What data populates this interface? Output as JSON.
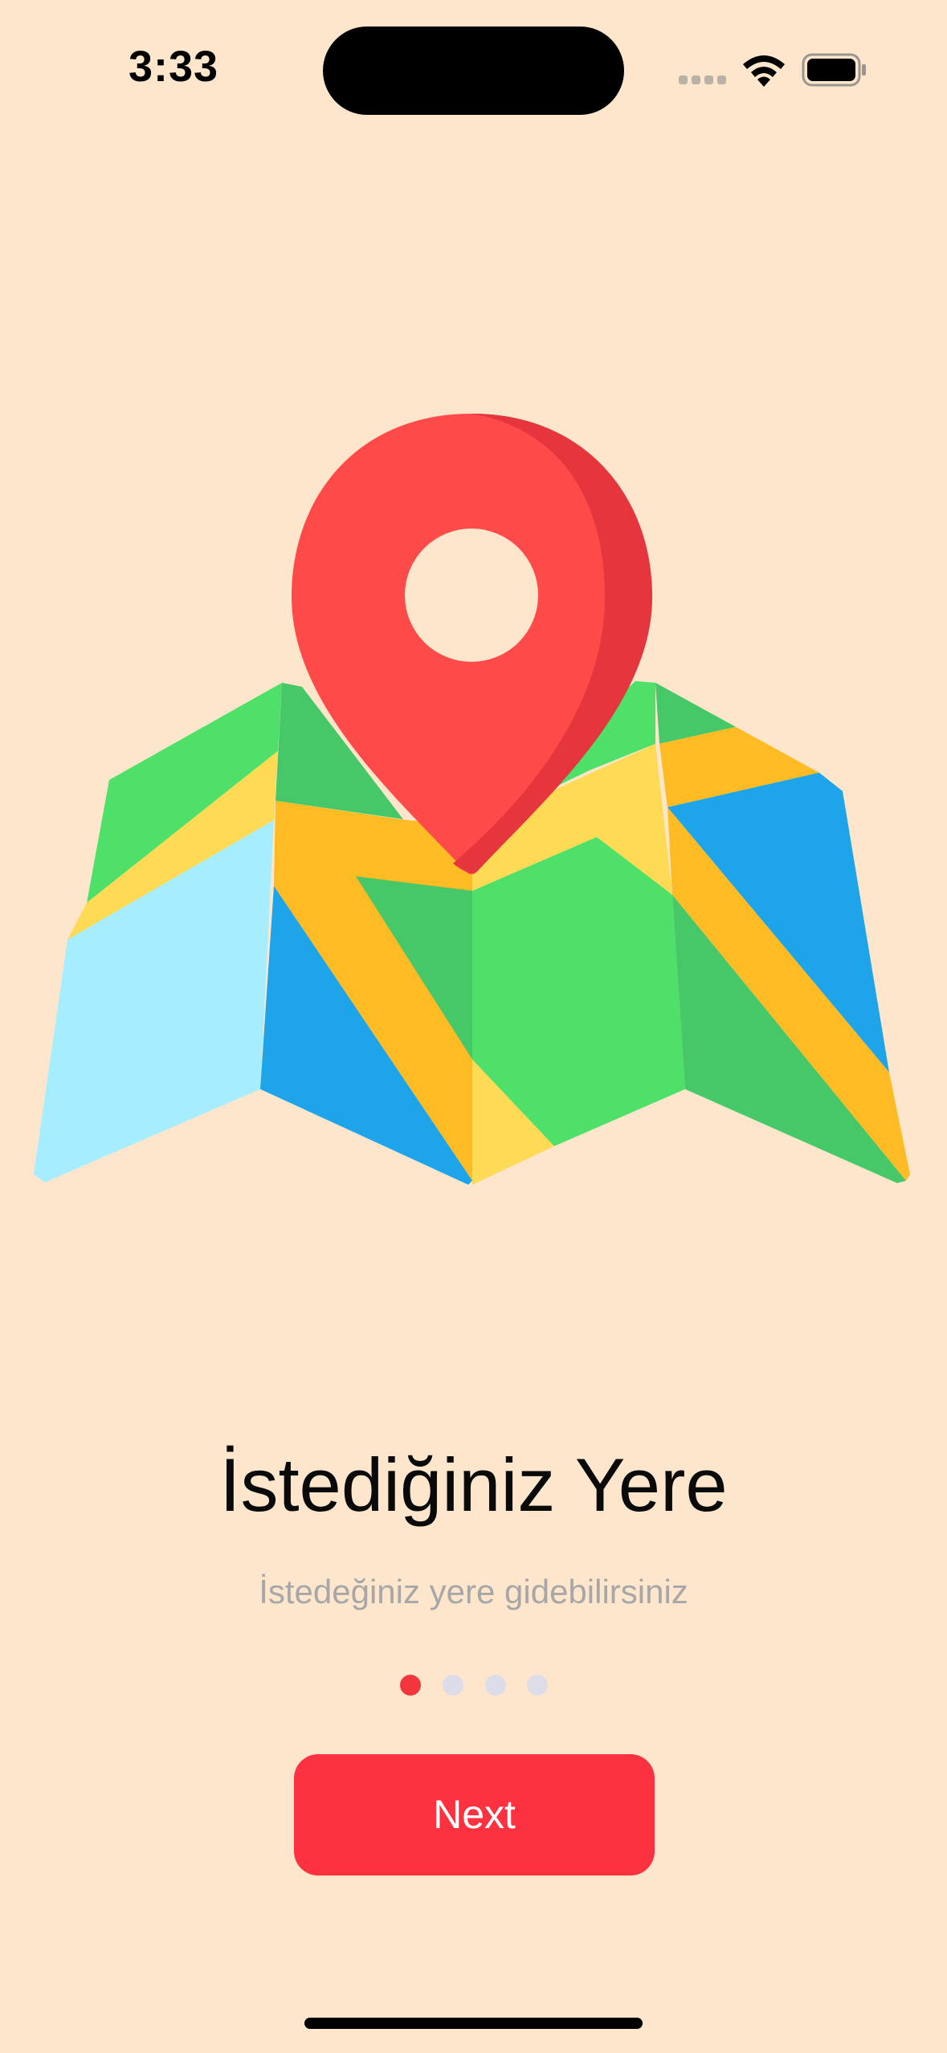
{
  "status_bar": {
    "time": "3:33",
    "icons": [
      "signal-icon",
      "wifi-icon",
      "battery-icon"
    ]
  },
  "illustration": {
    "icon": "map-location-pin-icon",
    "colors": {
      "pin": "#FF4A4A",
      "pin_shadow": "#E5353D",
      "green": "#4FE06A",
      "dark_green": "#46C868",
      "yellow": "#FFDA55",
      "orange": "#FFBB24",
      "blue": "#1EA4E9",
      "light_blue": "#A6EEFF"
    }
  },
  "onboarding": {
    "title": "İstediğiniz Yere",
    "subtitle": "İstedeğiniz yere gidebilirsiniz",
    "page_count": 4,
    "active_page": 1,
    "next_label": "Next"
  },
  "colors": {
    "background": "#FDE6CB",
    "accent": "#FC3240",
    "dot_inactive": "#DCDDE8",
    "subtitle": "#A7A7A7"
  }
}
